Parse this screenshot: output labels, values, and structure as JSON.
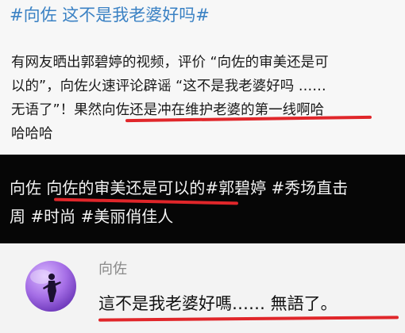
{
  "post": {
    "hashtag_title": "#向佐 这不是我老婆好吗#",
    "body_lines": [
      "有网友晒出郭碧婷的视频，评价 “向佐的审美还是可",
      "以的”，向佐火速评论辟谣 “这不是我老婆好吗 ……",
      "无语了”！果然向佐还是冲在维护老婆的第一线啊哈",
      "哈哈哈"
    ]
  },
  "caption": {
    "lines": [
      "向佐 向佐的审美还是可以的#郭碧婷 #秀场直击",
      "周 #时尚 #美丽俏佳人"
    ]
  },
  "comment": {
    "name": "向佐",
    "text": "這不是我老婆好嗎…… 無語了。",
    "avatar_icon": "user-avatar-icon"
  },
  "colors": {
    "hashtag": "#3b82c4",
    "underline": "#e0262a",
    "caption_bg": "#060606"
  }
}
